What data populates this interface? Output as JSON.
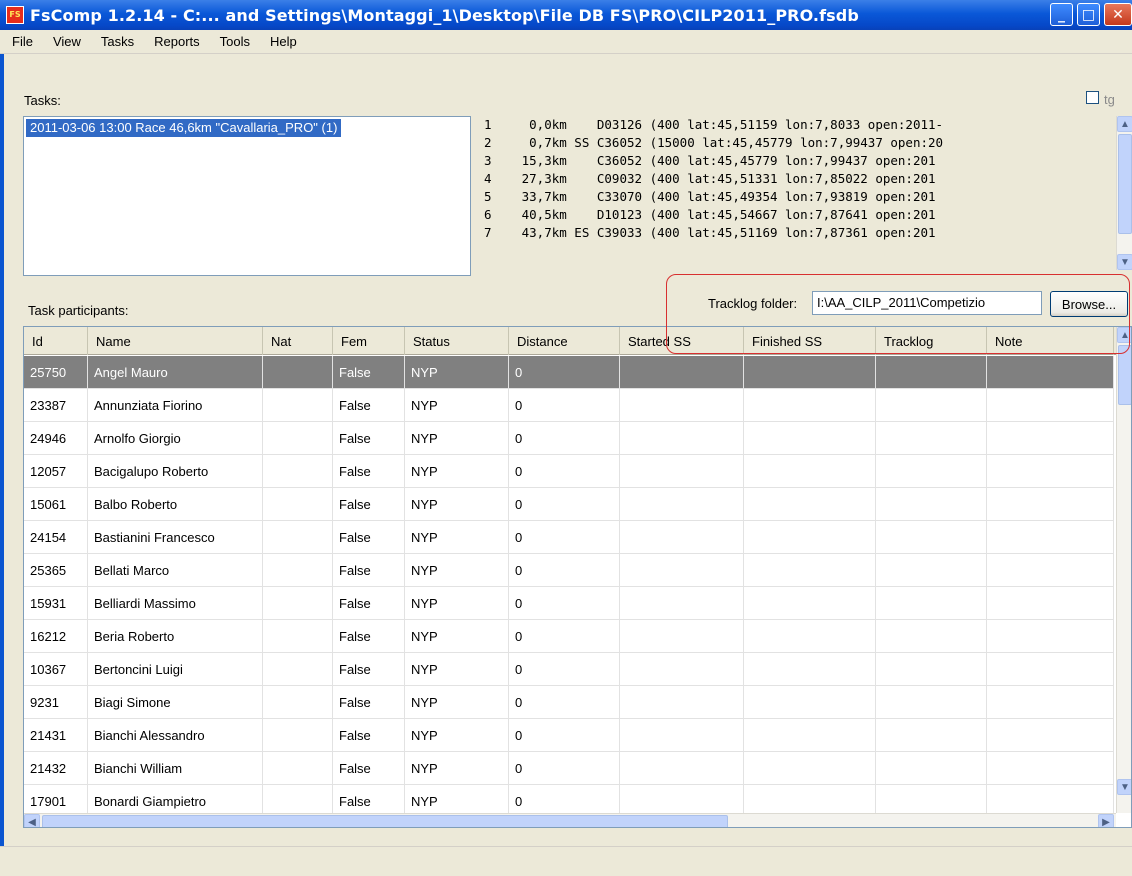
{
  "window": {
    "icon_text": "FS\nCMP",
    "title": "FsComp 1.2.14 - C:... and Settings\\Montaggi_1\\Desktop\\File DB FS\\PRO\\CILP2011_PRO.fsdb",
    "minimize": "_",
    "maximize": "□",
    "close": "✕"
  },
  "menu": [
    "File",
    "View",
    "Tasks",
    "Reports",
    "Tools",
    "Help"
  ],
  "tasks_label": "Tasks:",
  "tg_label": "tg",
  "tasks": [
    "2011-03-06 13:00 Race 46,6km \"Cavallaria_PRO\" (1)"
  ],
  "turnpoints": [
    "1     0,0km    D03126 (400 lat:45,51159 lon:7,8033 open:2011-",
    "2     0,7km SS C36052 (15000 lat:45,45779 lon:7,99437 open:20",
    "3    15,3km    C36052 (400 lat:45,45779 lon:7,99437 open:201",
    "4    27,3km    C09032 (400 lat:45,51331 lon:7,85022 open:201",
    "5    33,7km    C33070 (400 lat:45,49354 lon:7,93819 open:201",
    "6    40,5km    D10123 (400 lat:45,54667 lon:7,87641 open:201",
    "7    43,7km ES C39033 (400 lat:45,51169 lon:7,87361 open:201"
  ],
  "participants_label": "Task participants:",
  "tracklog": {
    "label": "Tracklog folder:",
    "value": "I:\\AA_CILP_2011\\Competizio",
    "browse": "Browse..."
  },
  "columns": [
    "Id",
    "Name",
    "Nat",
    "Fem",
    "Status",
    "Distance",
    "Started SS",
    "Finished SS",
    "Tracklog",
    "Note"
  ],
  "participants": [
    {
      "id": "25750",
      "name": "Angel Mauro",
      "nat": "",
      "fem": "False",
      "status": "NYP",
      "distance": "0"
    },
    {
      "id": "23387",
      "name": "Annunziata Fiorino",
      "nat": "",
      "fem": "False",
      "status": "NYP",
      "distance": "0"
    },
    {
      "id": "24946",
      "name": "Arnolfo Giorgio",
      "nat": "",
      "fem": "False",
      "status": "NYP",
      "distance": "0"
    },
    {
      "id": "12057",
      "name": "Bacigalupo Roberto",
      "nat": "",
      "fem": "False",
      "status": "NYP",
      "distance": "0"
    },
    {
      "id": "15061",
      "name": "Balbo Roberto",
      "nat": "",
      "fem": "False",
      "status": "NYP",
      "distance": "0"
    },
    {
      "id": "24154",
      "name": "Bastianini Francesco",
      "nat": "",
      "fem": "False",
      "status": "NYP",
      "distance": "0"
    },
    {
      "id": "25365",
      "name": "Bellati Marco",
      "nat": "",
      "fem": "False",
      "status": "NYP",
      "distance": "0"
    },
    {
      "id": "15931",
      "name": "Belliardi Massimo",
      "nat": "",
      "fem": "False",
      "status": "NYP",
      "distance": "0"
    },
    {
      "id": "16212",
      "name": "Beria Roberto",
      "nat": "",
      "fem": "False",
      "status": "NYP",
      "distance": "0"
    },
    {
      "id": "10367",
      "name": "Bertoncini Luigi",
      "nat": "",
      "fem": "False",
      "status": "NYP",
      "distance": "0"
    },
    {
      "id": "9231",
      "name": "Biagi Simone",
      "nat": "",
      "fem": "False",
      "status": "NYP",
      "distance": "0"
    },
    {
      "id": "21431",
      "name": "Bianchi Alessandro",
      "nat": "",
      "fem": "False",
      "status": "NYP",
      "distance": "0"
    },
    {
      "id": "21432",
      "name": "Bianchi William",
      "nat": "",
      "fem": "False",
      "status": "NYP",
      "distance": "0"
    },
    {
      "id": "17901",
      "name": "Bonardi Giampietro",
      "nat": "",
      "fem": "False",
      "status": "NYP",
      "distance": "0"
    }
  ],
  "colors": {
    "titlebar": "#0a58d8",
    "selection_task": "#316ac5",
    "selection_row": "#808080",
    "highlight_outline": "#d83030"
  }
}
